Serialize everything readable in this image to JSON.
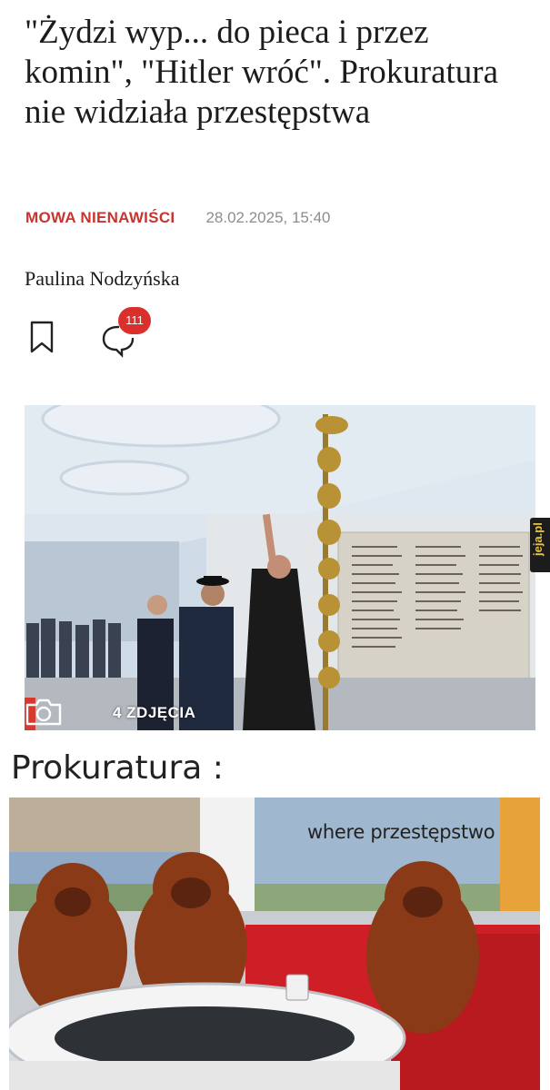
{
  "article": {
    "headline": "\"Żydzi wyp... do pieca i przez komin\", \"Hitler wróć\". Prokuratura nie widziała przestępstwa",
    "category": "MOWA NIENAWIŚCI",
    "date": "28.02.2025, 15:40",
    "author": "Paulina Nodzyńska",
    "comment_count": "111",
    "gallery_label": "4 ZDJĘCIA",
    "icons": [
      "bookmark-icon",
      "comment-icon",
      "camera-icon"
    ]
  },
  "watermark": "jeja.pl",
  "meme": {
    "caption": "Prokuratura :",
    "text": "where przestępstwo"
  },
  "colors": {
    "accent_red": "#c8342f",
    "badge_red": "#d9302c",
    "muted_gray": "#8d8d8d"
  }
}
